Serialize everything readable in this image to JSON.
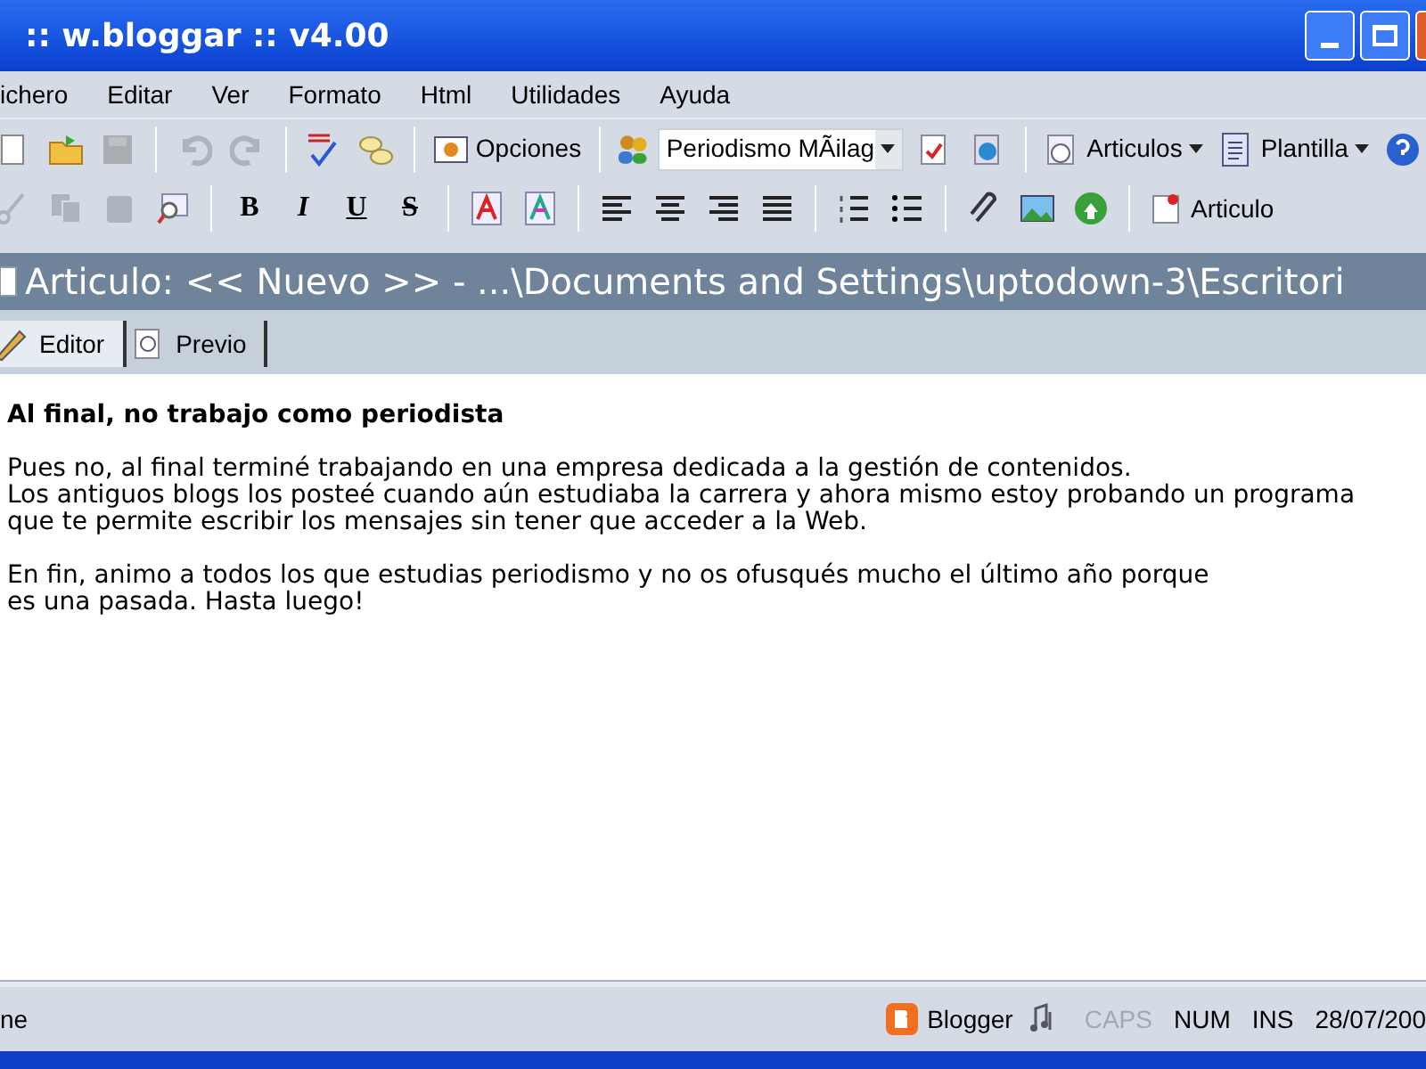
{
  "window": {
    "title": ":: w.bloggar :: v4.00"
  },
  "menu": [
    "ichero",
    "Editar",
    "Ver",
    "Formato",
    "Html",
    "Utilidades",
    "Ayuda"
  ],
  "toolbar_1": [
    {
      "kind": "icon",
      "disabled": false
    },
    {
      "kind": "icon",
      "disabled": false
    },
    {
      "kind": "icon",
      "disabled": true
    },
    {
      "kind": "sep"
    },
    {
      "kind": "icon",
      "disabled": true
    },
    {
      "kind": "icon",
      "disabled": true
    },
    {
      "kind": "sep"
    },
    {
      "kind": "icon",
      "disabled": false
    },
    {
      "kind": "icon",
      "disabled": false
    },
    {
      "kind": "sep"
    },
    {
      "kind": "button",
      "label": "Opciones"
    },
    {
      "kind": "sep"
    },
    {
      "kind": "combo",
      "value": "Periodismo MÃilag"
    },
    {
      "kind": "icon",
      "disabled": false
    },
    {
      "kind": "icon",
      "disabled": false
    },
    {
      "kind": "sep"
    },
    {
      "kind": "menu",
      "label": "Articulos"
    },
    {
      "kind": "menu",
      "label": "Plantilla"
    },
    {
      "kind": "icon",
      "disabled": false
    }
  ],
  "toolbar_2": [
    {
      "kind": "icon",
      "disabled": true
    },
    {
      "kind": "icon",
      "disabled": true
    },
    {
      "kind": "icon",
      "disabled": true
    },
    {
      "kind": "icon",
      "disabled": false
    },
    {
      "kind": "sep"
    },
    {
      "kind": "glyph",
      "label": "B"
    },
    {
      "kind": "glyph",
      "label": "I"
    },
    {
      "kind": "glyph",
      "label": "U"
    },
    {
      "kind": "glyph",
      "label": "S"
    },
    {
      "kind": "sep"
    },
    {
      "kind": "icon",
      "disabled": false
    },
    {
      "kind": "icon",
      "disabled": false
    },
    {
      "kind": "sep"
    },
    {
      "kind": "icon",
      "disabled": false
    },
    {
      "kind": "icon",
      "disabled": false
    },
    {
      "kind": "icon",
      "disabled": false
    },
    {
      "kind": "icon",
      "disabled": false
    },
    {
      "kind": "sep"
    },
    {
      "kind": "icon",
      "disabled": false
    },
    {
      "kind": "icon",
      "disabled": false
    },
    {
      "kind": "sep"
    },
    {
      "kind": "icon",
      "disabled": false
    },
    {
      "kind": "icon",
      "disabled": false
    },
    {
      "kind": "icon",
      "disabled": false
    },
    {
      "kind": "sep"
    },
    {
      "kind": "button",
      "label": "Articulo"
    }
  ],
  "document": {
    "title": "Articulo: << Nuevo >> - ...\\Documents and Settings\\uptodown-3\\Escritori"
  },
  "tabs": [
    {
      "label": "Editor",
      "selected": true
    },
    {
      "label": "Previo",
      "selected": false
    }
  ],
  "editor": {
    "heading": "Al final, no trabajo como periodista",
    "paragraphs": [
      [
        "Pues no, al final terminé trabajando en una empresa dedicada a la gestión de contenidos.",
        "Los antiguos blogs los posteé cuando aún estudiaba la carrera y ahora mismo estoy probando un programa",
        "que te permite escribir los mensajes sin tener que acceder a la Web."
      ],
      [
        "En fin, animo a todos los que estudias periodismo y no os ofusqués mucho el último año porque",
        "es una pasada. Hasta luego!"
      ]
    ]
  },
  "status_bar": {
    "left": "ne",
    "service": "Blogger",
    "indicators": [
      {
        "label": "CAPS",
        "on": false
      },
      {
        "label": "NUM",
        "on": true
      },
      {
        "label": "INS",
        "on": true
      }
    ],
    "date": "28/07/200"
  }
}
